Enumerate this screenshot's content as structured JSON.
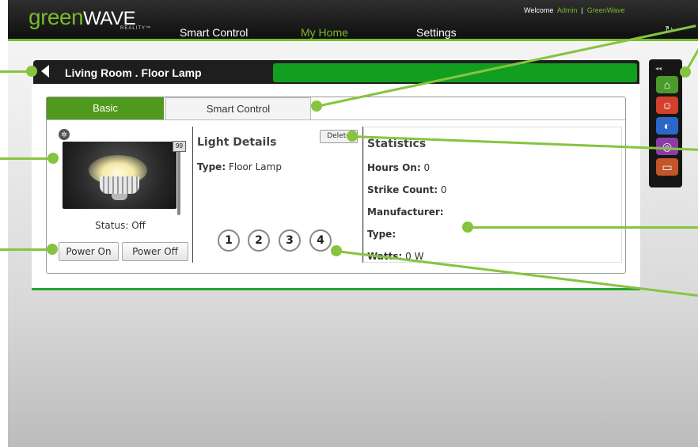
{
  "app": {
    "logo_prefix": "green",
    "logo_suffix": "WAVE",
    "logo_sub": "REALITY™",
    "welcome": "Welcome",
    "user": "Admin",
    "separator": "|",
    "account": "GreenWave",
    "refresh_icon": "refresh-icon"
  },
  "nav": {
    "items": [
      "Smart Control",
      "My Home",
      "Settings"
    ],
    "active": "My Home"
  },
  "header": {
    "title": "Living Room . Floor Lamp",
    "back_icon": "back-arrow-icon"
  },
  "tabs": {
    "basic": "Basic",
    "smart": "Smart Control"
  },
  "device": {
    "level": "99",
    "status": "Status: Off",
    "power_on": "Power On",
    "power_off": "Power Off"
  },
  "details": {
    "title": "Light Details",
    "delete": "Delete",
    "type_label": "Type:",
    "type_value": "Floor Lamp",
    "scene_buttons": [
      "1",
      "2",
      "3",
      "4"
    ]
  },
  "statistics": {
    "title": "Statistics",
    "hours_label": "Hours On:",
    "hours_value": "0",
    "strike_label": "Strike Count:",
    "strike_value": "0",
    "manufacturer_label": "Manufacturer:",
    "manufacturer_value": "",
    "type_label": "Type:",
    "type_value": "",
    "watts_label": "Watts:",
    "watts_value": "0 W"
  },
  "sidebar": {
    "collapse_text": "◂◂",
    "icons": [
      "home-icon",
      "running-person-icon",
      "moon-icon",
      "swirl-icon",
      "tv-icon"
    ],
    "icon_colors": [
      "#4c9a2a",
      "#d2412b",
      "#2a67c8",
      "#8a3da8",
      "#c2552a"
    ]
  },
  "colors": {
    "accent": "#7ab92c",
    "tab_active": "#4f9a1d",
    "header_progress": "#129e1e",
    "callout": "#86c440"
  }
}
